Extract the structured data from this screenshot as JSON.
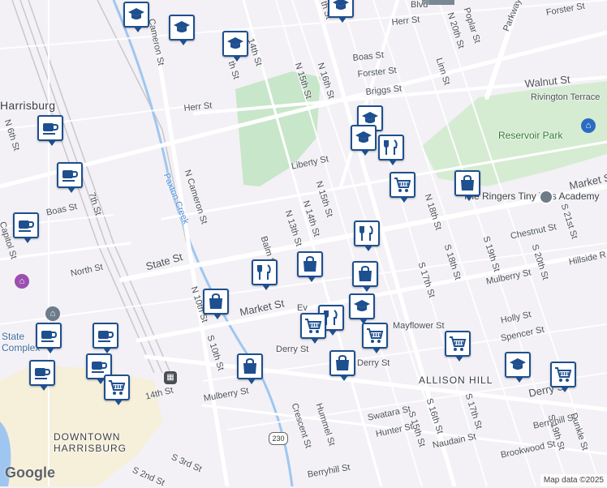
{
  "map": {
    "districts": [
      {
        "name": "DOWNTOWN",
        "line2": "HARRISBURG"
      },
      {
        "name": "ALLISON HILL"
      }
    ],
    "places": [
      {
        "name": "Reservoir Park"
      },
      {
        "name": "The Ringers Tiny Tots Academy"
      },
      {
        "name": "Harrisburg"
      }
    ],
    "streets": {
      "herr_st_w": "Herr St",
      "herr_st_e": "Herr St",
      "forster_st": "Forster St",
      "forster_st2": "Forster St",
      "boas_st": "Boas St",
      "boas_st2": "Boas St",
      "briggs_st": "Briggs St",
      "walnut_st": "Walnut St",
      "rivington": "Rivington Terrace",
      "liberty_st": "Liberty St",
      "market_st_e": "Market St",
      "market_st_w": "Market St",
      "state_st": "State St",
      "north_st": "North St",
      "chestnut_st": "Chestnut St",
      "mulberry_st": "Mulberry St",
      "mulberry_st2": "Mulberry St",
      "holly_st": "Holly St",
      "spencer_st": "Spencer St",
      "mayflower_st": "Mayflower St",
      "derry_st": "Derry St",
      "derry_st2": "Derry St",
      "derry_st3": "Derry St",
      "swatara_st": "Swatara St",
      "hunter_st": "Hunter St",
      "naudain_st": "Naudain St",
      "berryhill_st": "Berryhill St",
      "berryhill_st2": "Berryhill St",
      "brookwood_st": "Brookwood St",
      "crescent_st": "Crescent St",
      "hummel_st": "Hummel St",
      "n_cameron": "N Cameron St",
      "cameron": "Cameron St",
      "paxton_creek": "Paxton Creek",
      "n_6th": "N 6th St",
      "n_7th": "7th St",
      "capitol": "Capitol St",
      "n_10th": "N 10th St",
      "s_10th": "S 10th St",
      "n_13th": "N 13th St",
      "n_14th": "N 14th St",
      "n_15th": "N 15th St",
      "n_15th_b": "N 15th St",
      "n_16th": "N 16th St",
      "n_18th": "N 18th St",
      "n_20th": "N 20th St",
      "s_17th": "S 17th St",
      "s_17th_b": "S 17th St",
      "s_18th": "S 18th St",
      "s_19th": "S 19th St",
      "s_19th_b": "S 19th St",
      "s_20th": "S 20th St",
      "s_21st": "S 21st St",
      "s_16th": "S 16th St",
      "s_15th": "S 15th St",
      "s_14th": "14th St",
      "poplar": "Poplar St",
      "linn": "Linn St",
      "parkway": "Parkway",
      "dunkle": "Dunkle St",
      "balm": "Balm St",
      "evergreen": "Ev",
      "hillside": "Hillside R",
      "s_3rd": "S 3rd St",
      "s_2nd": "S 2nd St",
      "blvd": "Blvd",
      "n_14th_top": "14th St",
      "n_13th_top": "th St",
      "n_5th_top": "th St"
    },
    "route_shield": "230",
    "complex": "State",
    "complex2": "Complex",
    "colors": {
      "pin_border": "#1e4f8f",
      "park": "#c8e6c9",
      "water": "#9fc6f1",
      "road": "#ffffff",
      "bg": "#f3f1f5"
    },
    "pins": [
      {
        "icon": "school-icon"
      },
      {
        "icon": "school-icon"
      },
      {
        "icon": "school-icon"
      },
      {
        "icon": "school-icon"
      },
      {
        "icon": "school-icon"
      },
      {
        "icon": "school-icon"
      },
      {
        "icon": "school-icon"
      },
      {
        "icon": "school-icon"
      },
      {
        "icon": "cafe-icon"
      },
      {
        "icon": "cafe-icon"
      },
      {
        "icon": "cafe-icon"
      },
      {
        "icon": "cafe-icon"
      },
      {
        "icon": "cafe-icon"
      },
      {
        "icon": "cafe-icon"
      },
      {
        "icon": "cafe-icon"
      },
      {
        "icon": "restaurant-icon"
      },
      {
        "icon": "restaurant-icon"
      },
      {
        "icon": "restaurant-icon"
      },
      {
        "icon": "restaurant-icon"
      },
      {
        "icon": "grocery-icon"
      },
      {
        "icon": "grocery-icon"
      },
      {
        "icon": "grocery-icon"
      },
      {
        "icon": "grocery-icon"
      },
      {
        "icon": "grocery-icon"
      },
      {
        "icon": "grocery-icon"
      },
      {
        "icon": "shopping-icon"
      },
      {
        "icon": "shopping-icon"
      },
      {
        "icon": "shopping-icon"
      },
      {
        "icon": "shopping-icon"
      },
      {
        "icon": "shopping-icon"
      },
      {
        "icon": "shopping-icon"
      }
    ],
    "attribution": "Map data ©2025",
    "logo": "Google"
  }
}
